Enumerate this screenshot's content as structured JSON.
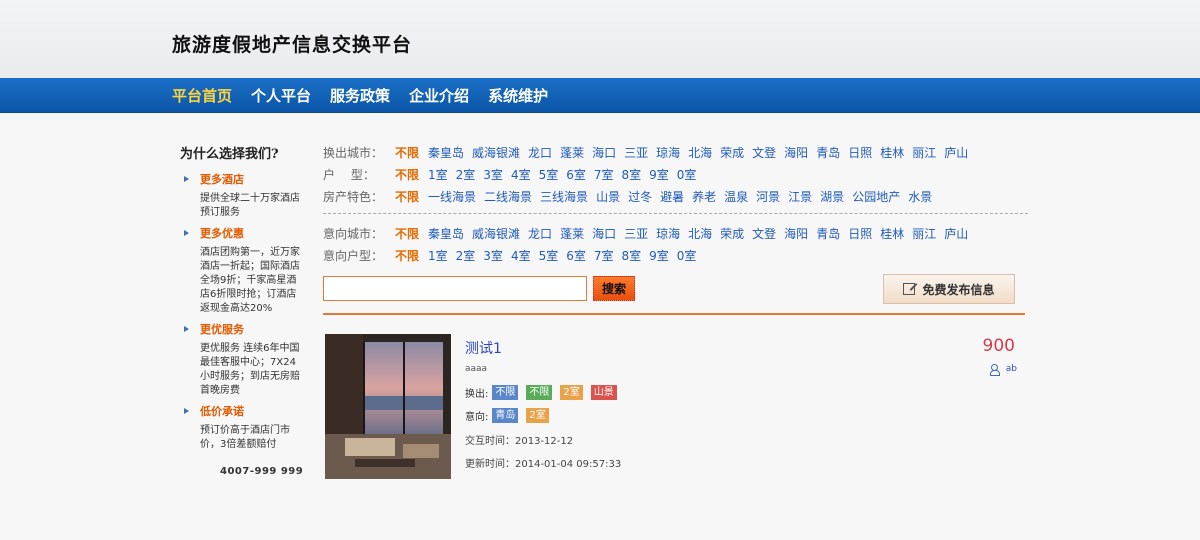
{
  "header": {
    "title": "旅游度假地产信息交换平台"
  },
  "nav": [
    "平台首页",
    "个人平台",
    "服务政策",
    "企业介绍",
    "系统维护"
  ],
  "sidebar": {
    "title": "为什么选择我们?",
    "sections": [
      {
        "head": "更多酒店",
        "text": "提供全球二十万家酒店预订服务"
      },
      {
        "head": "更多优惠",
        "text": "酒店团购第一，近万家酒店一折起；国际酒店全场9折；千家高星酒店6折限时抢；订酒店返现金高达20%"
      },
      {
        "head": "更优服务",
        "text": "更优服务 连续6年中国最佳客服中心；7X24小时服务；到店无房赔首晚房费"
      },
      {
        "head": "低价承诺",
        "text": "预订价高于酒店门市价，3倍差额赔付"
      }
    ],
    "phone": "4007-999 999"
  },
  "filters": {
    "out_city": {
      "label": "换出城市：",
      "selected": "不限",
      "options": [
        "秦皇岛",
        "威海银滩",
        "龙口",
        "蓬莱",
        "海口",
        "三亚",
        "琼海",
        "北海",
        "荣成",
        "文登",
        "海阳",
        "青岛",
        "日照",
        "桂林",
        "丽江",
        "庐山"
      ]
    },
    "unit_type": {
      "label": "户　 型：",
      "selected": "不限",
      "options": [
        "1室",
        "2室",
        "3室",
        "4室",
        "5室",
        "6室",
        "7室",
        "8室",
        "9室",
        "0室"
      ]
    },
    "feature": {
      "label": "房产特色：",
      "selected": "不限",
      "options": [
        "一线海景",
        "二线海景",
        "三线海景",
        "山景",
        "过冬",
        "避暑",
        "养老",
        "温泉",
        "河景",
        "江景",
        "湖景",
        "公园地产",
        "水景"
      ]
    },
    "intent_city": {
      "label": "意向城市：",
      "selected": "不限",
      "options": [
        "秦皇岛",
        "威海银滩",
        "龙口",
        "蓬莱",
        "海口",
        "三亚",
        "琼海",
        "北海",
        "荣成",
        "文登",
        "海阳",
        "青岛",
        "日照",
        "桂林",
        "丽江",
        "庐山"
      ]
    },
    "intent_unit": {
      "label": "意向户型：",
      "selected": "不限",
      "options": [
        "1室",
        "2室",
        "3室",
        "4室",
        "5室",
        "6室",
        "7室",
        "8室",
        "9室",
        "0室"
      ]
    }
  },
  "search": {
    "value": "",
    "button": "搜索",
    "publish": "免费发布信息"
  },
  "listing": {
    "title": "测试1",
    "desc": "aaaa",
    "price": "900",
    "user": "ab",
    "out_label": "换出:",
    "out_tags": [
      {
        "text": "不限",
        "color": "#5b86c9"
      },
      {
        "text": "不限",
        "color": "#5aab5a"
      },
      {
        "text": "2室",
        "color": "#e9a24a"
      },
      {
        "text": "山景",
        "color": "#d9534f"
      }
    ],
    "intent_label": "意向:",
    "intent_tags": [
      {
        "text": "青岛",
        "color": "#5b86c9"
      },
      {
        "text": "2室",
        "color": "#e9a24a"
      }
    ],
    "interact_time": "交互时间：2013-12-12",
    "update_time": "更新时间：2014-01-04 09:57:33"
  },
  "colors": {
    "nav_bg": "#0b56a8",
    "accent_orange": "#e56a00",
    "link_blue": "#1f5bb8",
    "price_red": "#d9394b"
  }
}
